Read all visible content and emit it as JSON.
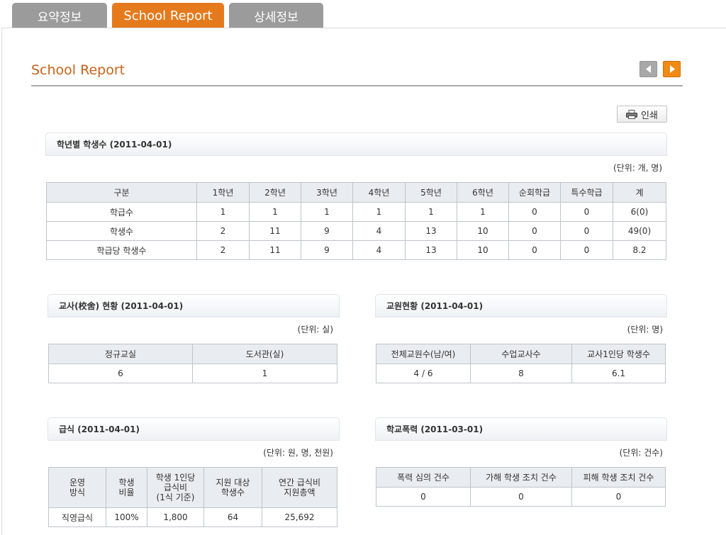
{
  "tabs": [
    {
      "label": "요약정보",
      "active": false
    },
    {
      "label": "School Report",
      "active": true
    },
    {
      "label": "상세정보",
      "active": false
    }
  ],
  "page_title": "School Report",
  "print_label": "인쇄",
  "colors": {
    "accent": "#e57a1d",
    "tab_inactive": "#9b9b9b",
    "title": "#c8621a",
    "header_bg": "#e9ecf0"
  },
  "grade_section": {
    "title": "학년별 학생수 (2011-04-01)",
    "unit": "(단위: 개, 명)",
    "headers": [
      "구분",
      "1학년",
      "2학년",
      "3학년",
      "4학년",
      "5학년",
      "6학년",
      "순회학급",
      "특수학급",
      "계"
    ],
    "rows": [
      [
        "학급수",
        "1",
        "1",
        "1",
        "1",
        "1",
        "1",
        "0",
        "0",
        "6(0)"
      ],
      [
        "학생수",
        "2",
        "11",
        "9",
        "4",
        "13",
        "10",
        "0",
        "0",
        "49(0)"
      ],
      [
        "학급당 학생수",
        "2",
        "11",
        "9",
        "4",
        "13",
        "10",
        "0",
        "0",
        "8.2"
      ]
    ]
  },
  "classroom_section": {
    "title": "교사(校舍) 현황 (2011-04-01)",
    "unit": "(단위: 실)",
    "headers": [
      "정규교실",
      "도서관(실)"
    ],
    "rows": [
      [
        "6",
        "1"
      ]
    ]
  },
  "staff_section": {
    "title": "교원현황 (2011-04-01)",
    "unit": "(단위: 명)",
    "headers": [
      "전체교원수(남/여)",
      "수업교사수",
      "교사1인당 학생수"
    ],
    "rows": [
      [
        "4 / 6",
        "8",
        "6.1"
      ]
    ]
  },
  "meal_section": {
    "title": "급식 (2011-04-01)",
    "unit": "(단위: 원, 명, 천원)",
    "headers": [
      "운영\n방식",
      "학생\n비율",
      "학생 1인당\n급식비\n(1식 기준)",
      "지원 대상\n학생수",
      "연간 급식비\n지원총액"
    ],
    "rows": [
      [
        "직영급식",
        "100%",
        "1,800",
        "64",
        "25,692"
      ]
    ]
  },
  "violence_section": {
    "title": "학교폭력 (2011-03-01)",
    "unit": "(단위: 건수)",
    "headers": [
      "폭력 심의 건수",
      "가해 학생 조치 건수",
      "피해 학생 조치 건수"
    ],
    "rows": [
      [
        "0",
        "0",
        "0"
      ]
    ]
  }
}
